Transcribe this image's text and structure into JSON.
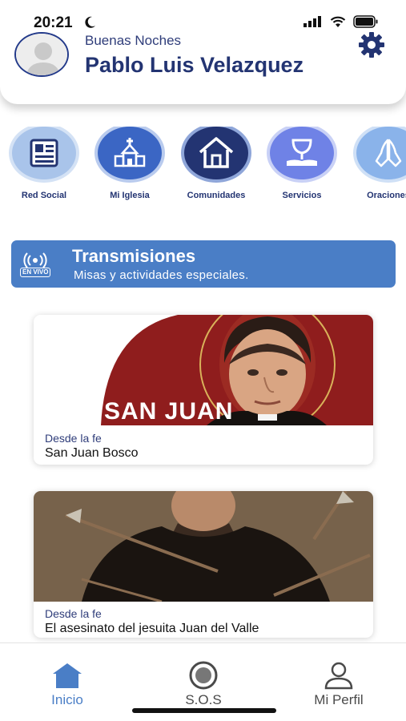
{
  "status_bar": {
    "time": "20:21"
  },
  "header": {
    "greeting": "Buenas Noches",
    "user_name": "Pablo Luis Velazquez"
  },
  "categories": [
    {
      "label": "Red Social",
      "icon": "newspaper-icon"
    },
    {
      "label": "Mi Iglesia",
      "icon": "church-icon"
    },
    {
      "label": "Comunidades",
      "icon": "home-community-icon"
    },
    {
      "label": "Servicios",
      "icon": "chalice-icon"
    },
    {
      "label": "Oraciones",
      "icon": "praying-hands-icon"
    }
  ],
  "live": {
    "badge": "EN VIVO",
    "title": "Transmisiones",
    "subtitle": "Misas y actividades especiales."
  },
  "cards": [
    {
      "image_text": "SAN JUAN",
      "category": "Desde la fe",
      "title": "San Juan Bosco"
    },
    {
      "category": "Desde la fe",
      "title": "El asesinato del jesuita Juan del Valle"
    }
  ],
  "nav": [
    {
      "label": "Inicio",
      "icon": "home-icon",
      "active": true
    },
    {
      "label": "S.O.S",
      "icon": "sos-icon",
      "active": false
    },
    {
      "label": "Mi Perfil",
      "icon": "profile-icon",
      "active": false
    }
  ],
  "colors": {
    "primary": "#233472",
    "live_banner": "#4a7ec6",
    "nav_active": "#4a7ec6",
    "nav_inactive": "#4a4a4a"
  }
}
